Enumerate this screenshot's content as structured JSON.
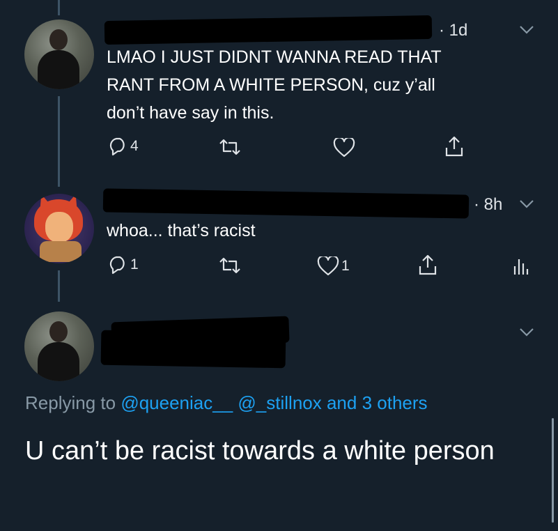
{
  "tweets": [
    {
      "time": "· 1d",
      "text": "LMAO I JUST DIDNT WANNA READ THAT\nRANT FROM A WHITE PERSON, cuz y’all\ndon’t have say in this.",
      "reply_count": "4",
      "retweet_count": "",
      "like_count": ""
    },
    {
      "time": "· 8h",
      "text": "whoa... that’s racist",
      "reply_count": "1",
      "retweet_count": "",
      "like_count": "1"
    }
  ],
  "focused": {
    "replying_label": "Replying to",
    "mentions": [
      "@queeniac__",
      "@_stillnox"
    ],
    "others": "and 3 others",
    "text": "U can’t be racist towards a white person"
  },
  "icons": {
    "reply": "reply-icon",
    "retweet": "retweet-icon",
    "like": "heart-icon",
    "share": "share-icon",
    "analytics": "analytics-icon",
    "more": "chevron-down-icon"
  },
  "colors": {
    "background": "#15202b",
    "link": "#1da1f2",
    "muted": "#8899a6"
  }
}
